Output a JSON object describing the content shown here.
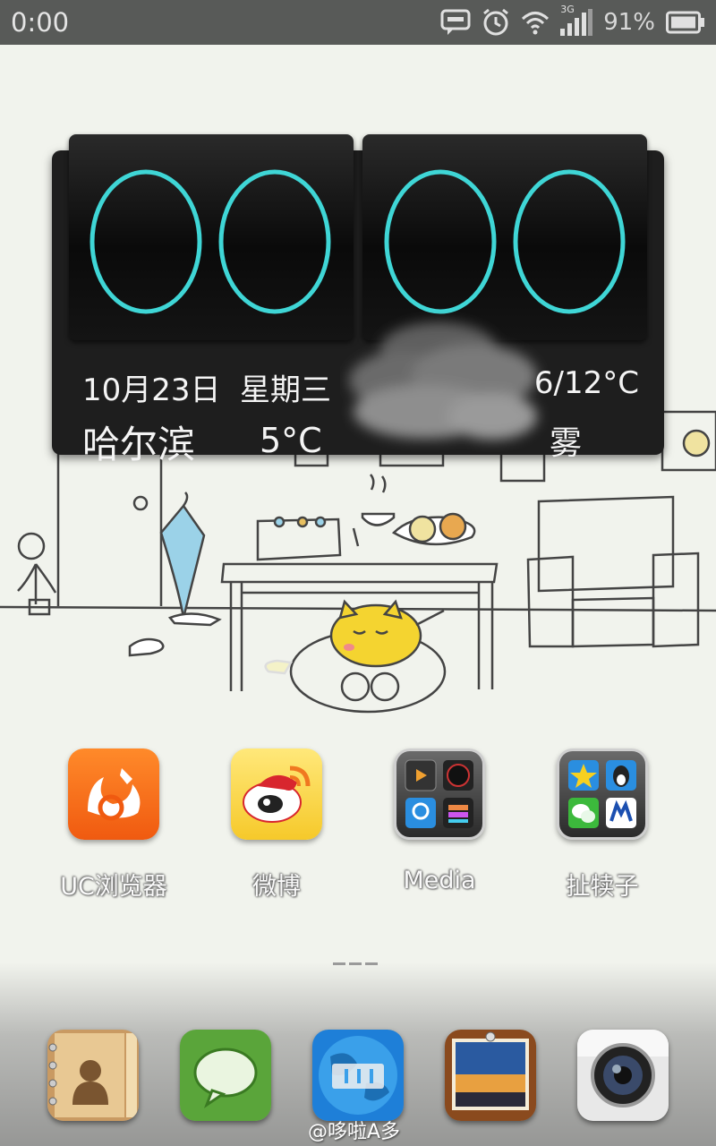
{
  "status_bar": {
    "time": "0:00",
    "network": "3G",
    "battery_percent": "91%",
    "icons": [
      "message-notification-icon",
      "alarm-icon",
      "wifi-icon",
      "signal-icon",
      "battery-icon"
    ]
  },
  "widget": {
    "clock_digits": [
      "0",
      "0",
      "0",
      "0"
    ],
    "date": "10月23日",
    "weekday": "星期三",
    "temp_range": "6/12°C",
    "city": "哈尔滨",
    "temperature": "5°C",
    "condition": "雾",
    "accent_color": "#3fd6d6"
  },
  "apps": [
    {
      "label": "UC浏览器",
      "icon": "uc-browser-icon"
    },
    {
      "label": "微博",
      "icon": "weibo-icon"
    },
    {
      "label": "Media",
      "icon": "media-folder-icon"
    },
    {
      "label": "扯犊子",
      "icon": "social-folder-icon"
    }
  ],
  "dock": [
    {
      "icon": "contacts-icon"
    },
    {
      "icon": "messages-icon"
    },
    {
      "icon": "browser-icon"
    },
    {
      "icon": "gallery-icon"
    },
    {
      "icon": "camera-icon"
    }
  ],
  "watermark": "@哆啦A多"
}
